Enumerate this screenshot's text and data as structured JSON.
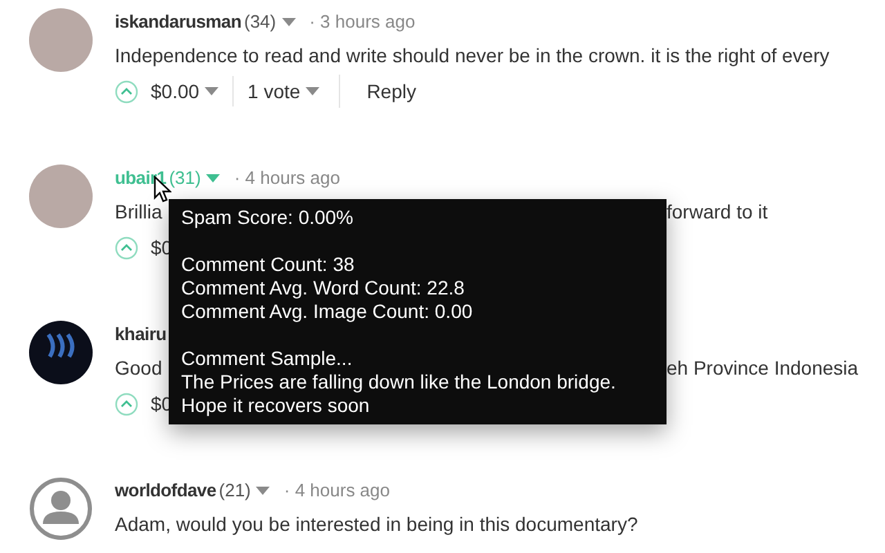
{
  "comments": [
    {
      "author": "iskandarusman",
      "reputation": "(34)",
      "time": "· 3 hours ago",
      "avatar": {
        "kind": "photo"
      },
      "hovered": false,
      "body": [
        "Independence to read and write should never be in the crown. it is the right of every"
      ],
      "actions": {
        "payout": "$0.00",
        "votes": "1 vote",
        "reply": "Reply"
      }
    },
    {
      "author": "ubair1",
      "reputation": "(31)",
      "time": "· 4 hours ago",
      "avatar": {
        "kind": "photo"
      },
      "hovered": true,
      "body": [
        "Brillia",
        "forward to it"
      ],
      "actions": {
        "payout": "$0"
      }
    },
    {
      "author": "khairu",
      "avatar": {
        "kind": "logo"
      },
      "hovered": false,
      "body": [
        "Good",
        "eh Province Indonesia"
      ],
      "actions": {
        "payout": "$0"
      }
    },
    {
      "author": "worldofdave",
      "reputation": "(21)",
      "time": "· 4 hours ago",
      "avatar": {
        "kind": "default"
      },
      "hovered": false,
      "body": [
        "Adam, would you be interested in being in this documentary?"
      ]
    }
  ],
  "tooltip": {
    "sections": [
      [
        "Spam Score: 0.00%"
      ],
      [
        "Comment Count: 38",
        "Comment Avg. Word Count: 22.8",
        "Comment Avg. Image Count: 0.00"
      ],
      [
        "Comment Sample...",
        "The Prices are falling down like the London bridge.",
        "Hope it recovers soon"
      ]
    ]
  }
}
